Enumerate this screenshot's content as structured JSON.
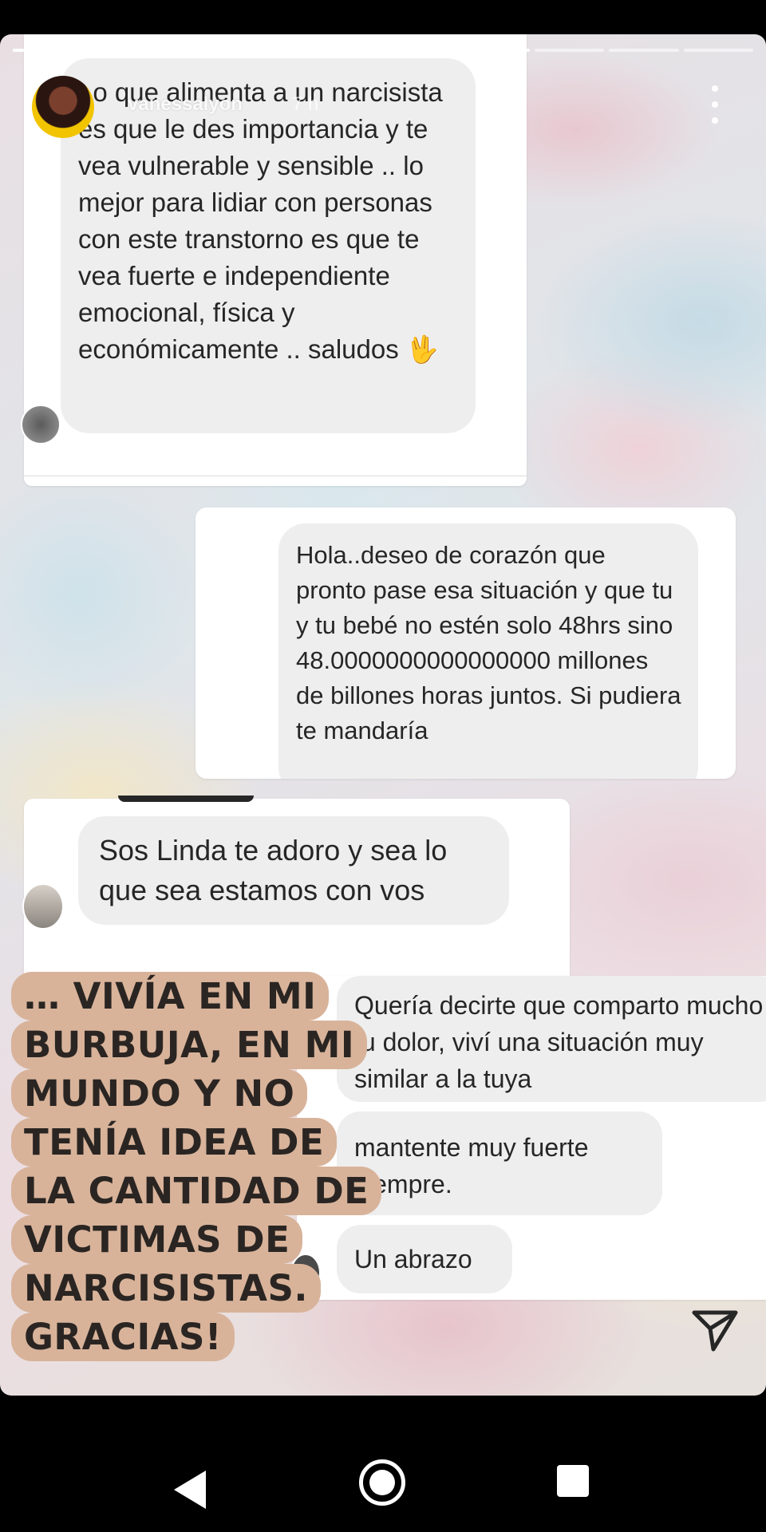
{
  "story": {
    "username": "vanessalyon",
    "time": "7 h",
    "progress_total": 10,
    "progress_done": 7
  },
  "messages": {
    "card1_text": "Lo que alimenta a un narcisista es que le des importancia y te vea vulnerable y sensible .. lo mejor para lidiar con personas con este transtorno es que te vea fuerte e independiente emocional, física y económicamente .. saludos 🖖",
    "card2_text": "Hola..deseo de corazón que pronto pase esa situación y que tu y tu bebé no estén solo 48hrs sino 48.0000000000000000 millones de billones horas juntos. Si pudiera te mandaría",
    "card3_text": "Sos Linda te adoro y sea lo que sea estamos con vos",
    "card4_msg1": "Quería decirte que comparto mucho tu dolor, viví una situación muy similar a la tuya",
    "card4_msg2": "mantente muy fuerte siempre.",
    "card4_msg3": "Un abrazo"
  },
  "overlay": {
    "lines": [
      "… VIVÍA EN MI",
      "BURBUJA, EN MI",
      "MUNDO Y NO",
      "TENÍA IDEA DE",
      "LA CANTIDAD DE",
      "VICTIMAS DE",
      "NARCISISTAS.",
      "GRACIAS!"
    ]
  },
  "icons": {
    "more": "more-vertical-icon",
    "send": "send-paper-plane-icon",
    "nav_back": "back-triangle-icon",
    "nav_home": "home-circle-icon",
    "nav_recents": "recents-square-icon"
  },
  "colors": {
    "overlay_bg": "#d8b39a",
    "bubble_bg": "#eeeeee"
  }
}
